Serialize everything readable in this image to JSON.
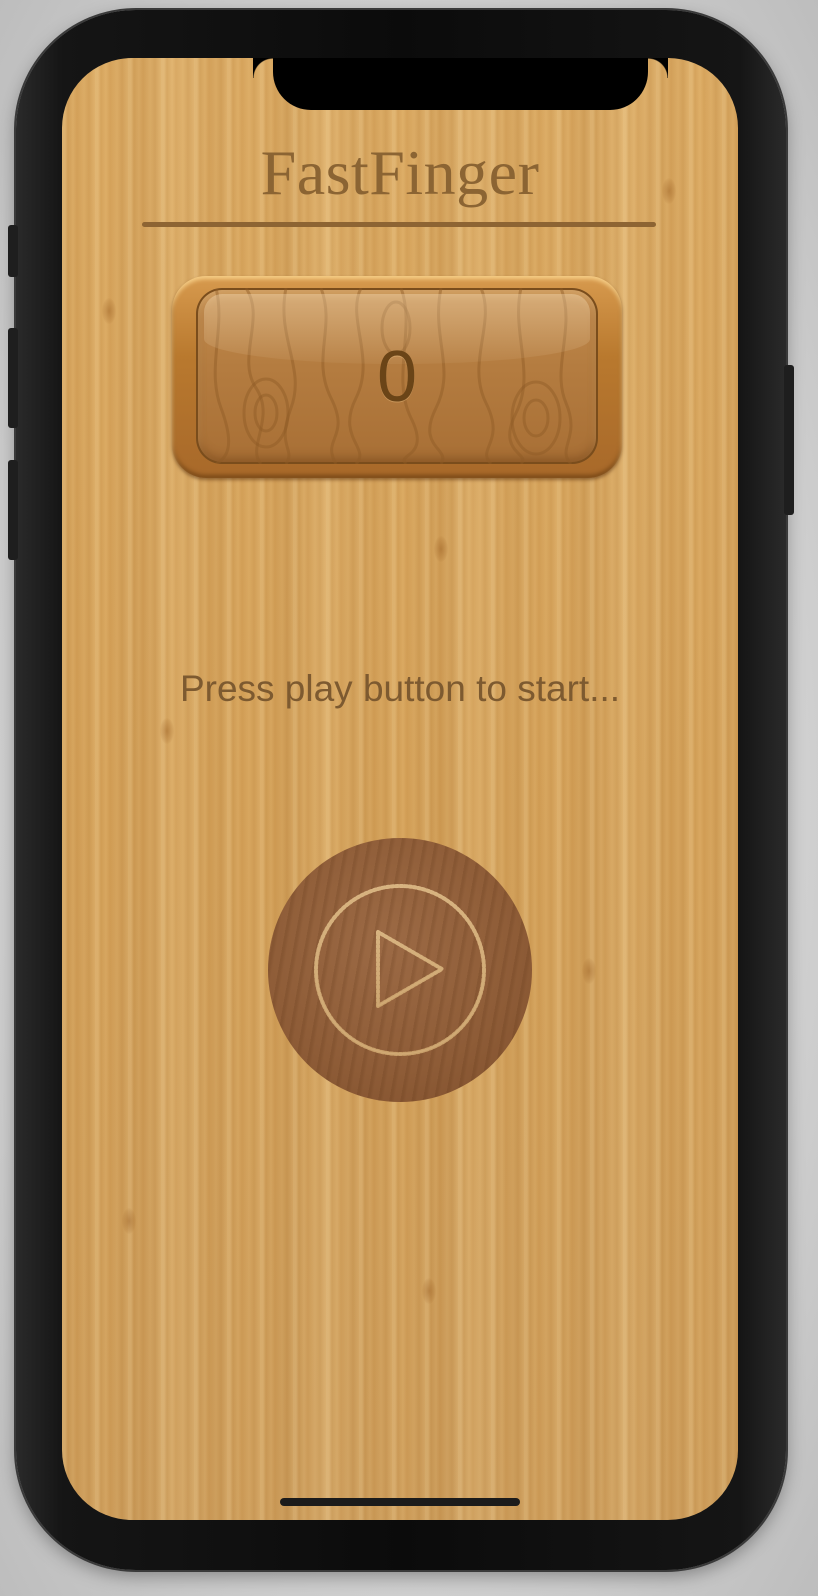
{
  "app": {
    "title": "FastFinger"
  },
  "score": {
    "value": "0"
  },
  "status": {
    "hint": "Press play button to start..."
  },
  "controls": {
    "play_icon": "play-icon"
  },
  "colors": {
    "wood_background": "#d8a85f",
    "title_text": "#8b6433",
    "score_text": "#6a4417",
    "hint_text": "#7d5a30",
    "play_button": "#8e5c37"
  }
}
